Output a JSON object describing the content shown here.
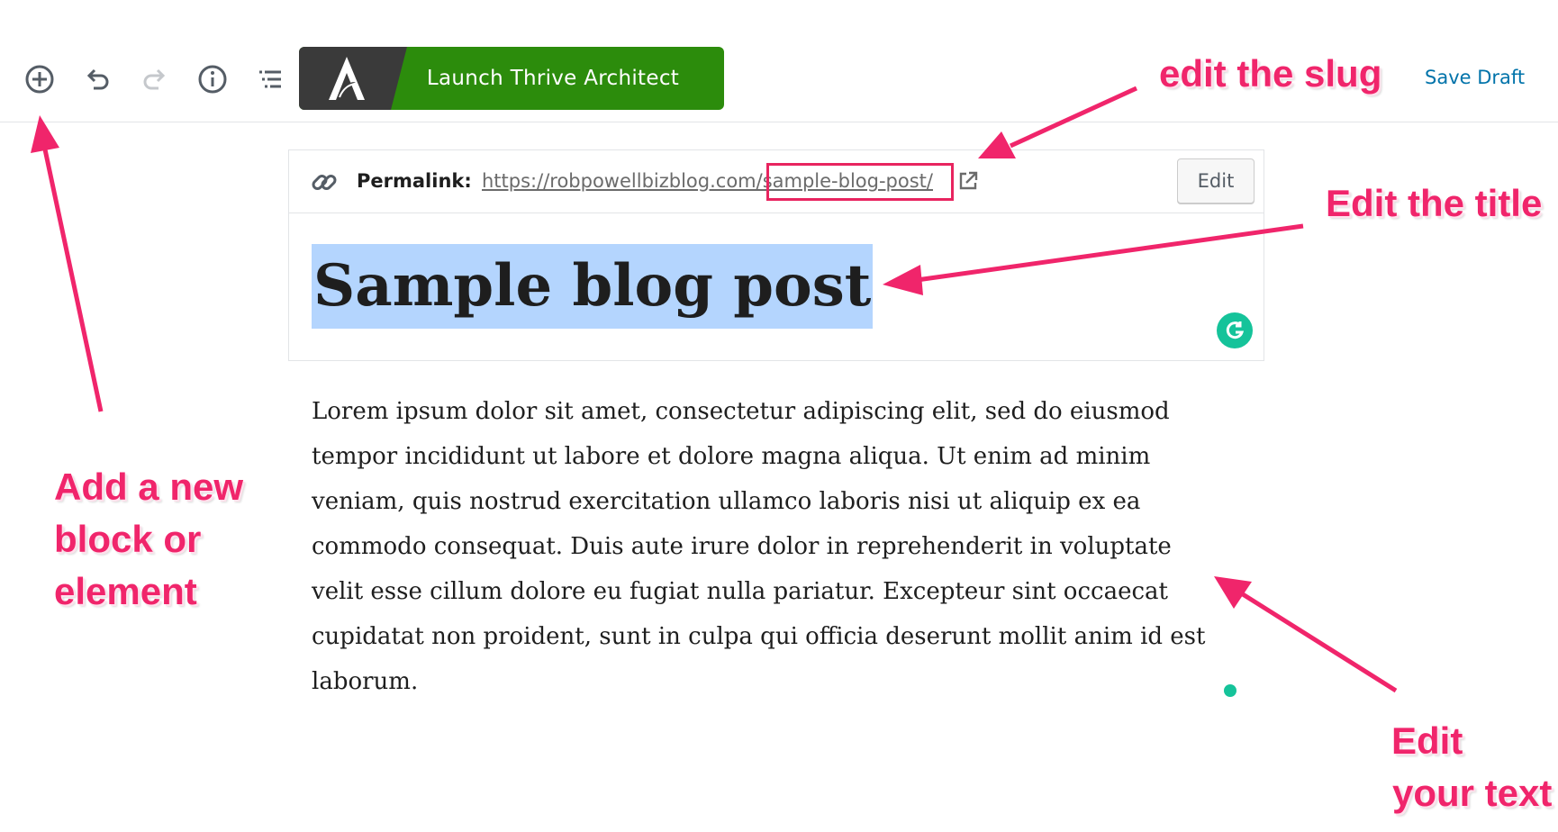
{
  "toolbar": {
    "add_block_icon": "plus-circle-icon",
    "undo_icon": "undo-icon",
    "redo_icon": "redo-icon",
    "info_icon": "info-icon",
    "outline_icon": "list-outline-icon",
    "thrive_button_label": "Launch Thrive Architect",
    "thrive_logo_icon": "thrive-architect-logo-icon",
    "save_draft_label": "Save Draft"
  },
  "permalink": {
    "label": "Permalink:",
    "url": "https://robpowellbizblog.com/sample-blog-post/",
    "edit_label": "Edit"
  },
  "post": {
    "title": "Sample blog post",
    "body_lines": [
      "Lorem ipsum dolor sit amet, consectetur adipiscing elit, sed do eiusmod",
      "tempor incididunt ut labore et dolore magna aliqua. Ut enim ad minim",
      "veniam, quis nostrud exercitation ullamco laboris nisi ut aliquip ex ea",
      "commodo consequat. Duis aute irure dolor in reprehenderit in voluptate",
      "velit esse cillum dolore eu fugiat nulla pariatur. Excepteur sint occaecat",
      "cupidatat non proident, sunt in culpa qui officia deserunt mollit anim id est",
      "laborum."
    ]
  },
  "annotations": {
    "slug": "edit the slug",
    "title": "Edit the title",
    "block_lines": [
      "Add a new",
      "block or",
      "element"
    ],
    "text_lines": [
      "Edit",
      "your text"
    ]
  },
  "colors": {
    "annotation": "#f0256b",
    "thrive_green": "#2c8c0c",
    "title_highlight": "#b4d5fe",
    "link_blue": "#0073aa",
    "grammarly": "#15c39a"
  }
}
